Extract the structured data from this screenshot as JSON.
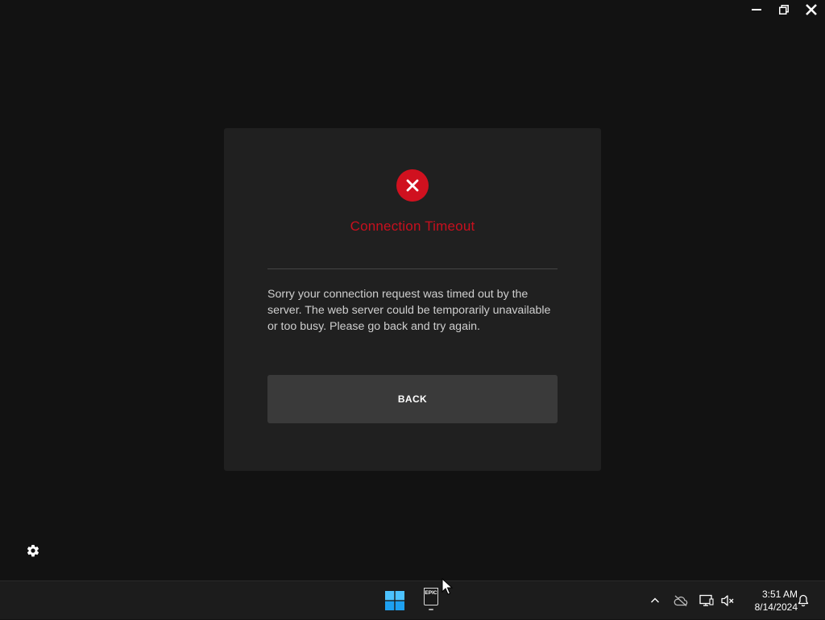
{
  "window_controls": {
    "minimize_icon": "minimize-icon",
    "restore_icon": "restore-icon",
    "close_icon": "close-icon"
  },
  "dialog": {
    "icon": "error-x-icon",
    "title": "Connection Timeout",
    "message": "Sorry your connection request was timed out by the server. The web server could be temporarily unavailable or too busy. Please go back and try again.",
    "back_label": "BACK",
    "accent_color": "#d0111f"
  },
  "settings": {
    "icon": "gear-icon"
  },
  "taskbar": {
    "start_icon": "windows-start-icon",
    "app_name": "Epic Games Launcher",
    "app_logo_text": "EPIC",
    "tray": {
      "overflow_icon": "chevron-up-icon",
      "cloud_icon": "cloud-offline-icon",
      "network_icon": "network-icon",
      "volume_icon": "volume-muted-icon"
    },
    "time": "3:51 AM",
    "date": "8/14/2024",
    "notification_icon": "bell-icon"
  }
}
